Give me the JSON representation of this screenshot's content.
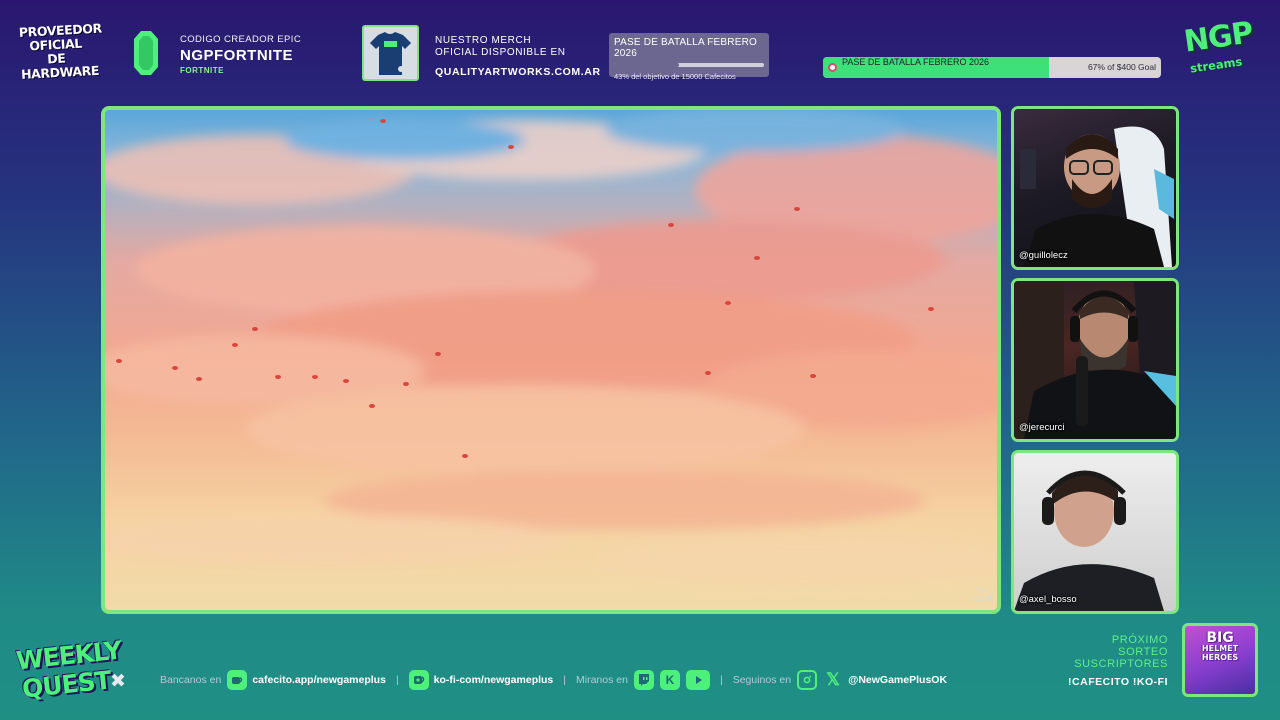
{
  "header": {
    "hardware_label": "PROVEEDOR OFICIAL DE HARDWARE",
    "epic": {
      "label": "CODIGO CREADOR EPIC",
      "code": "NGPFORTNITE",
      "game": "FORTNITE"
    },
    "merch": {
      "line1": "NUESTRO MERCH",
      "line2": "OFICIAL DISPONIBLE EN",
      "url": "QUALITYARTWORKS.COM.AR"
    },
    "goal_card": {
      "title": "PASE DE BATALLA FEBRERO 2026",
      "subtitle": "43% del objetivo de 15000 Cafecitos",
      "progress_percent": 43
    },
    "goal_bar": {
      "title": "PASE DE BATALLA FEBRERO 2026",
      "status": "67% of $400 Goal",
      "progress_percent": 67
    },
    "brand": {
      "logo_text": "NGP",
      "sub": "streams"
    }
  },
  "game": {
    "platform_icon": "playstation-icon",
    "scene": "sunset-sky-with-falling-leaves"
  },
  "cams": [
    {
      "handle": "@guillolecz"
    },
    {
      "handle": "@jerecurci"
    },
    {
      "handle": "@axel_bosso"
    }
  ],
  "footer": {
    "show_logo_line1": "WEEKLY",
    "show_logo_line2": "QUEST",
    "show_logo_mark": "✖",
    "bancanos_label": "Bancanos en",
    "cafecito_url": "cafecito.app/newgameplus",
    "kofi_url": "ko-fi-com/newgameplus",
    "miranos_label": "Miranos en",
    "seguinos_label": "Seguinos en",
    "social_handle": "@NewGamePlusOK",
    "separator": "|",
    "raffle": {
      "line1": "PRÓXIMO",
      "line2": "SORTEO",
      "line3": "SUSCRIPTORES",
      "commands": "!CAFECITO  !KO-FI"
    },
    "game_thumb": {
      "title_top": "BIG",
      "title_mid": "HELMET",
      "title_bot": "HEROES"
    }
  },
  "colors": {
    "accent_green": "#7de67c",
    "brand_green": "#4ef07c",
    "bg_top": "#2a1670",
    "bg_bottom": "#1f8f84"
  }
}
